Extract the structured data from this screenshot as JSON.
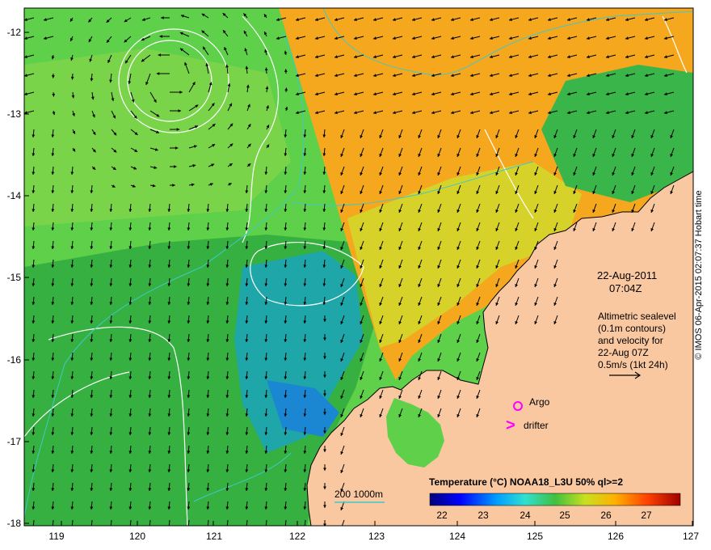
{
  "axes": {
    "y_ticks": [
      "-12",
      "-13",
      "-14",
      "-15",
      "-16",
      "-17",
      "-18"
    ],
    "x_ticks": [
      "119",
      "120",
      "121",
      "122",
      "123",
      "124",
      "125",
      "126",
      "127"
    ]
  },
  "annotation": {
    "date": "22-Aug-2011",
    "time": "07:04Z",
    "info_lines": [
      "Altimetric sealevel",
      "(0.1m contours)",
      "and velocity for",
      "22-Aug 07Z",
      "0.5m/s (1kt 24h)"
    ]
  },
  "markers": {
    "argo": {
      "label": "Argo",
      "symbol": "circle",
      "color": "#ff00ff"
    },
    "drifter": {
      "label": "drifter",
      "symbol": ">",
      "color": "#ff00ff"
    }
  },
  "depth_legend": {
    "label": "200  1000m",
    "color": "#40c8c8"
  },
  "colorbar": {
    "title": "Temperature (°C) NOAA18_L3U 50% ql>=2",
    "ticks": [
      "22",
      "23",
      "24",
      "25",
      "26",
      "27"
    ]
  },
  "credit": "© IMOS 06-Apr-2015 02:07:37 Hobart time",
  "colors": {
    "land": "#fac8a0",
    "sst_cool": "#2ca83a",
    "sst_mid": "#5ed04a",
    "sst_warm": "#f5a81e",
    "contour_sealevel": "#ffffff",
    "contour_depth": "#40c8c8",
    "velocity_arrow": "#000000"
  }
}
